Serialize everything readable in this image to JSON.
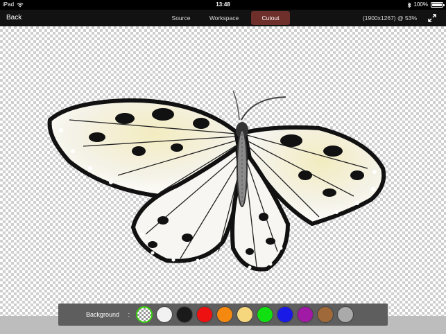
{
  "status_bar": {
    "device": "iPad",
    "time": "13:48",
    "battery": "100%"
  },
  "nav": {
    "back_label": "Back",
    "tabs": [
      {
        "label": "Source",
        "active": false
      },
      {
        "label": "Workspace",
        "active": false
      },
      {
        "label": "Cutout",
        "active": true
      }
    ],
    "image_info": "(1900x1267) @  53%"
  },
  "colors": {
    "active_tab": "#6e2f2b",
    "selected_swatch_ring": "#39d10f"
  },
  "background_toolbar": {
    "label": "Background",
    "separator": ":",
    "swatches": [
      {
        "name": "transparent",
        "color": "checker",
        "selected": true
      },
      {
        "name": "white",
        "color": "#f2f2f2"
      },
      {
        "name": "black",
        "color": "#1a1a1a"
      },
      {
        "name": "red",
        "color": "#ee1111"
      },
      {
        "name": "orange",
        "color": "#f5890f"
      },
      {
        "name": "yellow",
        "color": "#f7d77d"
      },
      {
        "name": "green",
        "color": "#12df12"
      },
      {
        "name": "blue",
        "color": "#1a1ae6"
      },
      {
        "name": "purple",
        "color": "#a01aa5"
      },
      {
        "name": "brown",
        "color": "#a0693a"
      },
      {
        "name": "gray",
        "color": "#aaaaaa"
      }
    ]
  }
}
